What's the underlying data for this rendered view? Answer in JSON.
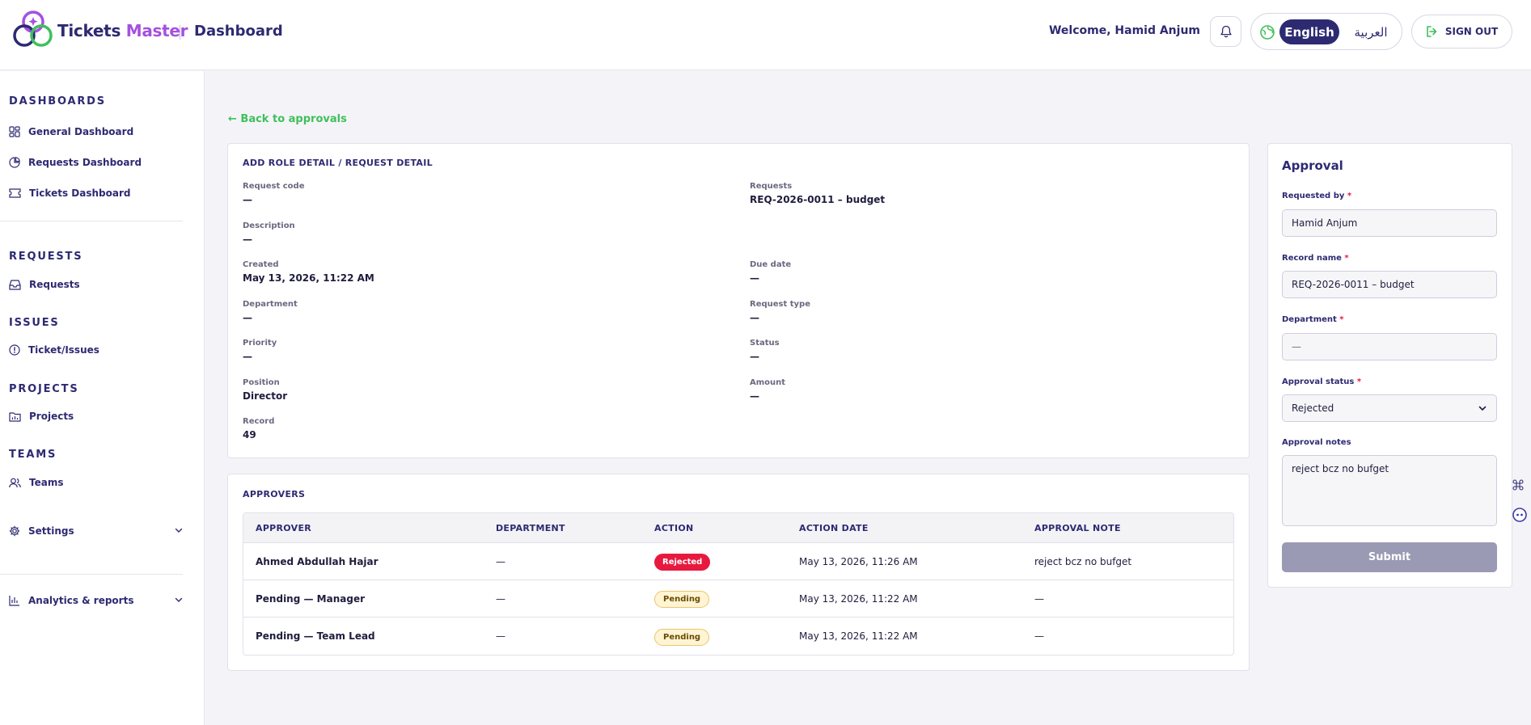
{
  "header": {
    "brand_part1": "Tickets",
    "brand_part2": "Master",
    "page_title": "Dashboard",
    "welcome": "Welcome, Hamid Anjum",
    "lang_en": "English",
    "lang_ar": "العربية",
    "signout": "SIGN OUT"
  },
  "sidebar": {
    "sections": {
      "dashboards": "DASHBOARDS",
      "requests": "REQUESTS",
      "issues": "ISSUES",
      "projects": "PROJECTS",
      "teams": "TEAMS"
    },
    "items": {
      "general_dashboard": "General Dashboard",
      "requests_dashboard": "Requests Dashboard",
      "tickets_dashboard": "Tickets Dashboard",
      "requests": "Requests",
      "tickets_issues": "Ticket/Issues",
      "projects": "Projects",
      "teams": "Teams",
      "settings": "Settings",
      "analytics": "Analytics & reports"
    }
  },
  "main": {
    "back_link": "← Back to approvals",
    "detail_title": "ADD ROLE DETAIL / REQUEST DETAIL",
    "fields": {
      "request_code": {
        "label": "Request code",
        "value": "—"
      },
      "requests": {
        "label": "Requests",
        "value": "REQ-2026-0011 – budget"
      },
      "description": {
        "label": "Description",
        "value": "—"
      },
      "created": {
        "label": "Created",
        "value": "May 13, 2026, 11:22 AM"
      },
      "due_date": {
        "label": "Due date",
        "value": "—"
      },
      "department": {
        "label": "Department",
        "value": "—"
      },
      "request_type": {
        "label": "Request type",
        "value": "—"
      },
      "priority": {
        "label": "Priority",
        "value": "—"
      },
      "status": {
        "label": "Status",
        "value": "—"
      },
      "position": {
        "label": "Position",
        "value": "Director"
      },
      "amount": {
        "label": "Amount",
        "value": "—"
      },
      "record": {
        "label": "Record",
        "value": "49"
      }
    },
    "approvers_title": "APPROVERS",
    "table": {
      "headers": [
        "APPROVER",
        "DEPARTMENT",
        "ACTION",
        "ACTION DATE",
        "APPROVAL NOTE"
      ],
      "rows": [
        {
          "approver": "Ahmed Abdullah Hajar",
          "department": "—",
          "action": "Rejected",
          "date": "May 13, 2026, 11:26 AM",
          "note": "reject bcz no bufget"
        },
        {
          "approver": "Pending — Manager",
          "department": "—",
          "action": "Pending",
          "date": "May 13, 2026, 11:22 AM",
          "note": "—"
        },
        {
          "approver": "Pending — Team Lead",
          "department": "—",
          "action": "Pending",
          "date": "May 13, 2026, 11:22 AM",
          "note": "—"
        }
      ]
    }
  },
  "approval": {
    "title": "Approval",
    "requested_by_label": "Requested by",
    "requested_by_value": "Hamid Anjum",
    "record_name_label": "Record name",
    "record_name_value": "REQ-2026-0011 – budget",
    "department_label": "Department",
    "department_value": "—",
    "status_label": "Approval status",
    "status_value": "Rejected",
    "notes_label": "Approval notes",
    "notes_value": "reject bcz no bufget",
    "submit": "Submit",
    "required_mark": "*"
  },
  "colors": {
    "primary": "#2d2a72",
    "accent": "#a551e0",
    "link_green": "#3fbf5c",
    "rejected": "#e8193f",
    "pending_bg": "#fff4d4"
  }
}
